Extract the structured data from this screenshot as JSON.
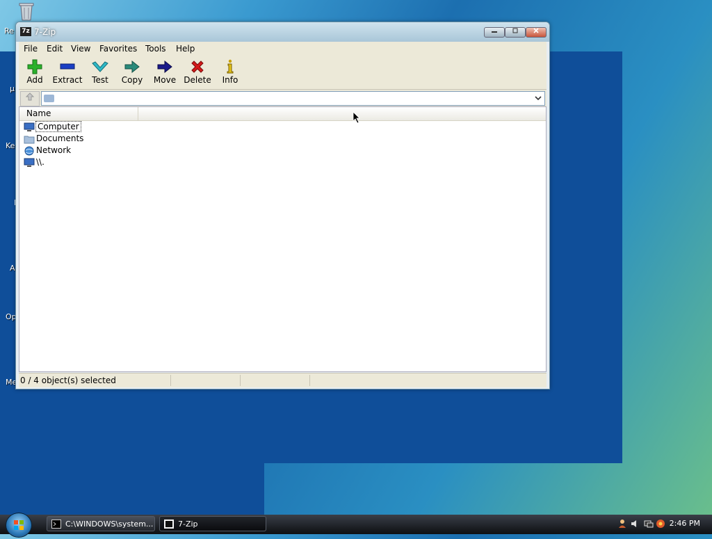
{
  "desktop": {
    "labels": [
      "Re",
      "µ",
      "Ke",
      "I",
      "A",
      "Op",
      "Me"
    ]
  },
  "window": {
    "title": "7-Zip",
    "icon_text": "7z",
    "controls": [
      "minimize",
      "maximize",
      "close"
    ]
  },
  "menu": {
    "items": [
      "File",
      "Edit",
      "View",
      "Favorites",
      "Tools",
      "Help"
    ]
  },
  "toolbar": {
    "buttons": [
      {
        "label": "Add",
        "icon": "plus-icon",
        "color": "#2bb12b"
      },
      {
        "label": "Extract",
        "icon": "minus-icon",
        "color": "#1a3fc4"
      },
      {
        "label": "Test",
        "icon": "check-icon",
        "color": "#2fb9c7"
      },
      {
        "label": "Copy",
        "icon": "arrow-right-icon",
        "color": "#2a8a7a"
      },
      {
        "label": "Move",
        "icon": "arrow-right-icon",
        "color": "#1a1a8a"
      },
      {
        "label": "Delete",
        "icon": "x-icon",
        "color": "#d41a1a"
      },
      {
        "label": "Info",
        "icon": "info-icon",
        "color": "#c8a000"
      }
    ]
  },
  "address": {
    "value": ""
  },
  "list": {
    "columns": [
      "Name"
    ],
    "items": [
      {
        "name": "Computer",
        "icon": "computer-icon"
      },
      {
        "name": "Documents",
        "icon": "folder-icon"
      },
      {
        "name": "Network",
        "icon": "network-icon"
      },
      {
        "name": "\\\\.",
        "icon": "computer-icon"
      }
    ]
  },
  "status": {
    "selection": "0 / 4 object(s) selected"
  },
  "taskbar": {
    "tasks": [
      {
        "label": "C:\\WINDOWS\\system..."
      },
      {
        "label": "7-Zip"
      }
    ],
    "clock": "2:46 PM"
  }
}
